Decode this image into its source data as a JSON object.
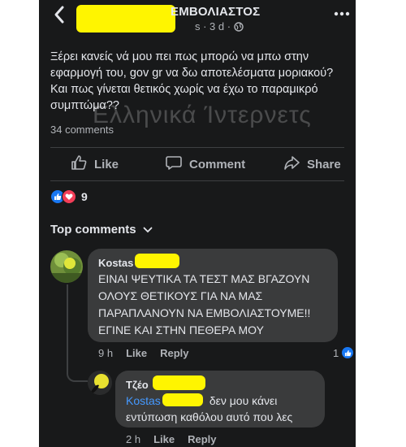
{
  "header": {
    "title": "ΕΜΒΟΛΙΑΣΤΟΣ",
    "meta_time": "s · 3 d ·",
    "icons": {
      "back": "back-arrow-icon",
      "more": "more-dots-icon",
      "privacy": "globe-icon"
    }
  },
  "post": {
    "text": "Ξέρει κανείς νά μου πει πως μπορώ να μπω στην εφαρμογή του, gov gr να δω αποτελέσματα μοριακού? Και πως γίνεται θετικός χωρίς να έχω το παραμικρό συμπτώμα??",
    "watermark": "Ελληνικά Ίντερνετς",
    "comments_count": "34 comments"
  },
  "actions": {
    "like": "Like",
    "comment": "Comment",
    "share": "Share"
  },
  "reactions": {
    "count": "9",
    "types": [
      "like",
      "love"
    ]
  },
  "comments_header": "Top comments",
  "comments": [
    {
      "author": "Kostas",
      "text_lines": [
        "ΕΙΝΑΙ ΨΕΥΤΙΚΑ ΤΑ ΤΕΣΤ ΜΑΣ ΒΓΑΖΟΥΝ",
        "ΟΛΟΥΣ ΘΕΤΙΚΟΥΣ ΓΙΑ ΝΑ ΜΑΣ",
        "ΠΑΡΑΠΛΑΝΟΥΝ ΝΑ ΕΜΒΟΛΙΑΣΤΟΥΜΕ!!",
        "ΕΓΙΝΕ ΚΑΙ ΣΤΗΝ ΠΕΘΕΡΑ ΜΟΥ"
      ],
      "time": "9 h",
      "like_label": "Like",
      "reply_label": "Reply",
      "reaction_count": "1"
    },
    {
      "author": "Τζέο",
      "mention": "Kostas",
      "text_line1": "δεν μου κάνει",
      "text_line2": "εντύπωση καθόλου αυτό που λες",
      "time": "2 h",
      "like_label": "Like",
      "reply_label": "Reply"
    }
  ],
  "colors": {
    "background": "#18191a",
    "bubble": "#3a3b3c",
    "text": "#e4e6eb",
    "secondary": "#b0b3b8",
    "mention": "#4599ff",
    "like_blue": "#1877f2",
    "love_red": "#f33e58",
    "redaction": "#fff500"
  }
}
